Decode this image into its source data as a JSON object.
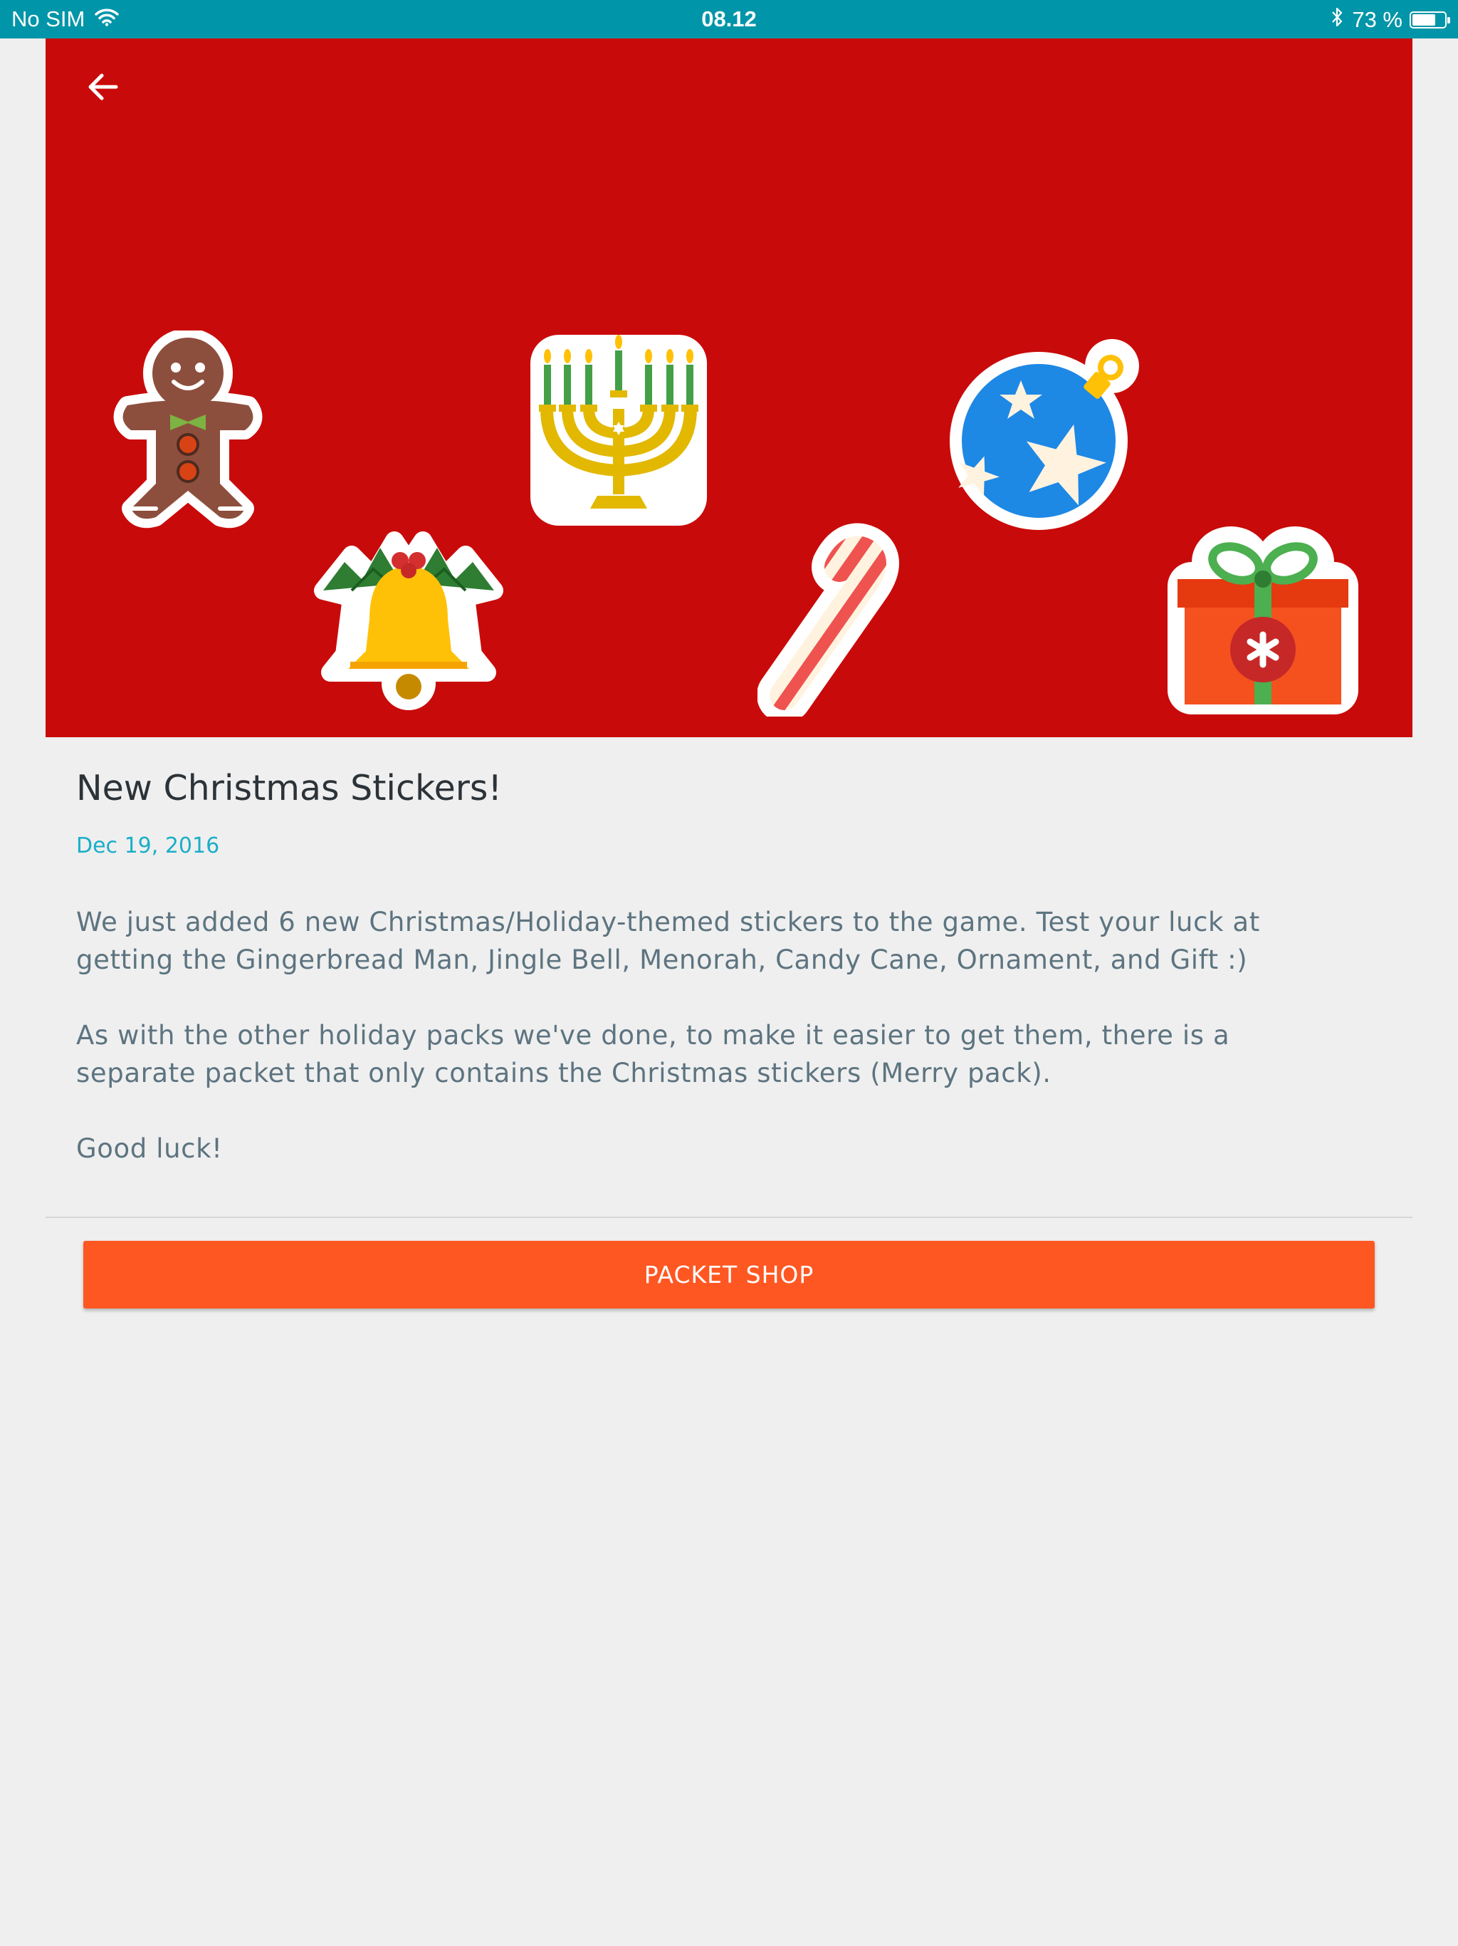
{
  "status_bar": {
    "carrier": "No SIM",
    "time": "08.12",
    "battery_percent_label": "73 %",
    "battery_level": 0.73,
    "icons": [
      "wifi-icon",
      "bluetooth-icon",
      "battery-icon"
    ]
  },
  "hero": {
    "background_color": "#c90a0a",
    "back_icon": "arrow-left-icon",
    "stickers": [
      "gingerbread-man-sticker",
      "jingle-bell-sticker",
      "menorah-sticker",
      "candy-cane-sticker",
      "ornament-sticker",
      "gift-sticker"
    ]
  },
  "article": {
    "title": "New Christmas Stickers!",
    "date": "Dec 19, 2016",
    "paragraphs": [
      "We just added 6 new Christmas/Holiday-themed stickers to the game. Test your luck at getting the Gingerbread Man, Jingle Bell, Menorah, Candy Cane, Ornament, and Gift :)",
      "As with the other holiday packs we've done, to make it easier to get them, there is a separate packet that only contains the Christmas stickers (Merry pack).",
      "Good luck!"
    ]
  },
  "actions": {
    "packet_shop_label": "PACKET SHOP",
    "accent_color": "#ff5722"
  }
}
